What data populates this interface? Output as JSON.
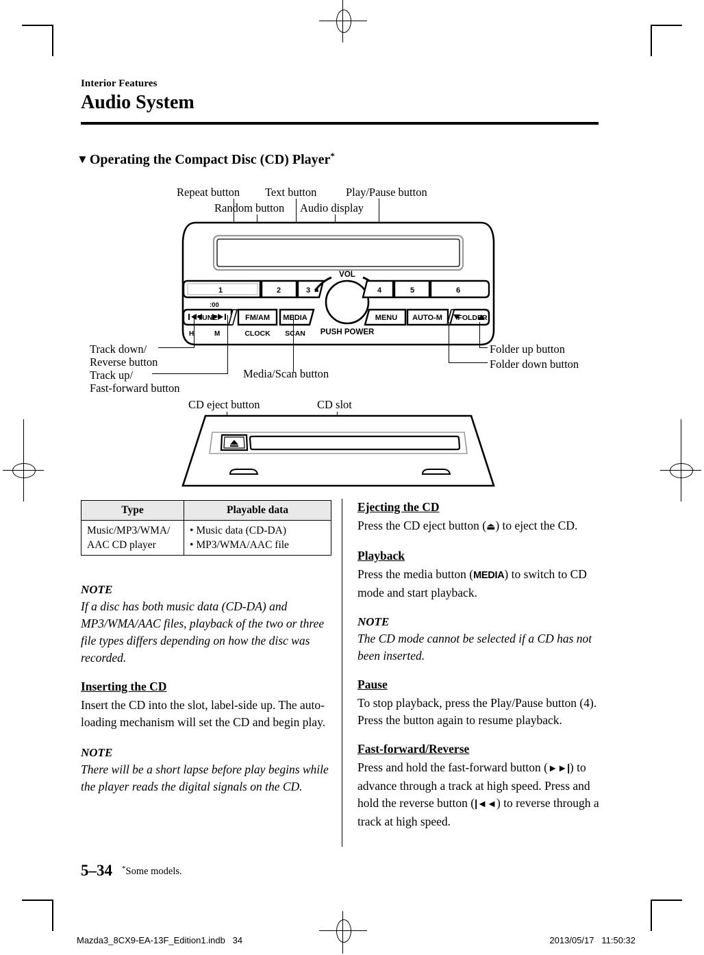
{
  "header": {
    "section": "Interior Features",
    "title": "Audio System"
  },
  "section_heading": {
    "triangle": "▼",
    "text": "Operating the Compact Disc (CD) Player",
    "footnote_mark": "*"
  },
  "diagram": {
    "top_labels": [
      {
        "name": "repeat-button",
        "text": "Repeat button"
      },
      {
        "name": "text-button",
        "text": "Text button"
      },
      {
        "name": "play-pause-button",
        "text": "Play/Pause button"
      },
      {
        "name": "random-button",
        "text": "Random button"
      },
      {
        "name": "audio-display",
        "text": "Audio display"
      }
    ],
    "left_labels": [
      {
        "name": "track-down-reverse",
        "line1": "Track down/",
        "line2": "Reverse button"
      },
      {
        "name": "track-up-fast-forward",
        "line1": "Track up/",
        "line2": "Fast-forward button"
      }
    ],
    "center_label": {
      "name": "media-scan-button",
      "text": "Media/Scan button"
    },
    "right_labels": [
      {
        "name": "folder-up-button",
        "text": "Folder up button"
      },
      {
        "name": "folder-down-button",
        "text": "Folder down button"
      }
    ],
    "faceplate": {
      "preset_buttons": [
        "1",
        "2",
        "3",
        "4",
        "5",
        "6"
      ],
      "clock_indicator": ":00",
      "tune_label": "TUNE",
      "tune_prev_glyph": "◄◄",
      "tune_next_glyph": "►►",
      "h_label": "H",
      "m_label": "M",
      "fm_am_label": "FM/AM",
      "clock_label": "CLOCK",
      "media_label": "MEDIA",
      "scan_label": "SCAN",
      "vol_label": "VOL",
      "push_power_label": "PUSH POWER",
      "menu_label": "MENU",
      "auto_m_label": "AUTO-M",
      "folder_label": "FOLDER",
      "folder_down_glyph": "▼",
      "folder_up_glyph": "▲"
    },
    "cd_panel_labels": [
      {
        "name": "cd-eject-button",
        "text": "CD eject button"
      },
      {
        "name": "cd-slot",
        "text": "CD slot"
      }
    ],
    "cd_panel": {
      "eject_glyph": "▲"
    }
  },
  "table": {
    "headers": [
      "Type",
      "Playable data"
    ],
    "rows": [
      {
        "type_line1": "Music/MP3/WMA/",
        "type_line2": "AAC CD player",
        "data": [
          "Music data (CD-DA)",
          "MP3/WMA/AAC file"
        ]
      }
    ],
    "bullet": "•"
  },
  "left_column": {
    "blocks": [
      {
        "kind": "note",
        "label": "NOTE",
        "body": "If a disc has both music data (CD-DA) and MP3/WMA/AAC files, playback of the two or three file types differs depending on how the disc was recorded."
      },
      {
        "kind": "section",
        "heading": "Inserting the CD",
        "body": "Insert the CD into the slot, label-side up. The auto-loading mechanism will set the CD and begin play."
      },
      {
        "kind": "note",
        "label": "NOTE",
        "body": "There will be a short lapse before play begins while the player reads the digital signals on the CD."
      }
    ]
  },
  "right_column": {
    "blocks": [
      {
        "kind": "section",
        "heading": "Ejecting the CD",
        "body_pre": "Press the CD eject button (",
        "inline_glyph": "⏏",
        "body_post": ") to eject the CD."
      },
      {
        "kind": "section",
        "heading": "Playback",
        "body_pre": "Press the media button (",
        "inline_btn": "MEDIA",
        "body_post": ") to switch to CD mode and start playback."
      },
      {
        "kind": "note",
        "label": "NOTE",
        "body": "The CD mode cannot be selected if a CD has not been inserted."
      },
      {
        "kind": "section",
        "heading": "Pause",
        "body": "To stop playback, press the Play/Pause button (4).",
        "body2": "Press the button again to resume playback."
      },
      {
        "kind": "section",
        "heading": "Fast-forward/Reverse",
        "body_pre": "Press and hold the fast-forward button (",
        "glyph_ff": "►►|",
        "body_mid": ") to advance through a track at high speed. Press and hold the reverse button (",
        "glyph_rev": "|◄◄",
        "body_post": ") to reverse through a track at high speed."
      }
    ]
  },
  "footer": {
    "page_number": "5–34",
    "footnote_mark": "*",
    "footnote": "Some models.",
    "file_name": "Mazda3_8CX9-EA-13F_Edition1.indb",
    "file_page": "34",
    "date": "2013/05/17",
    "time": "11:50:32"
  }
}
